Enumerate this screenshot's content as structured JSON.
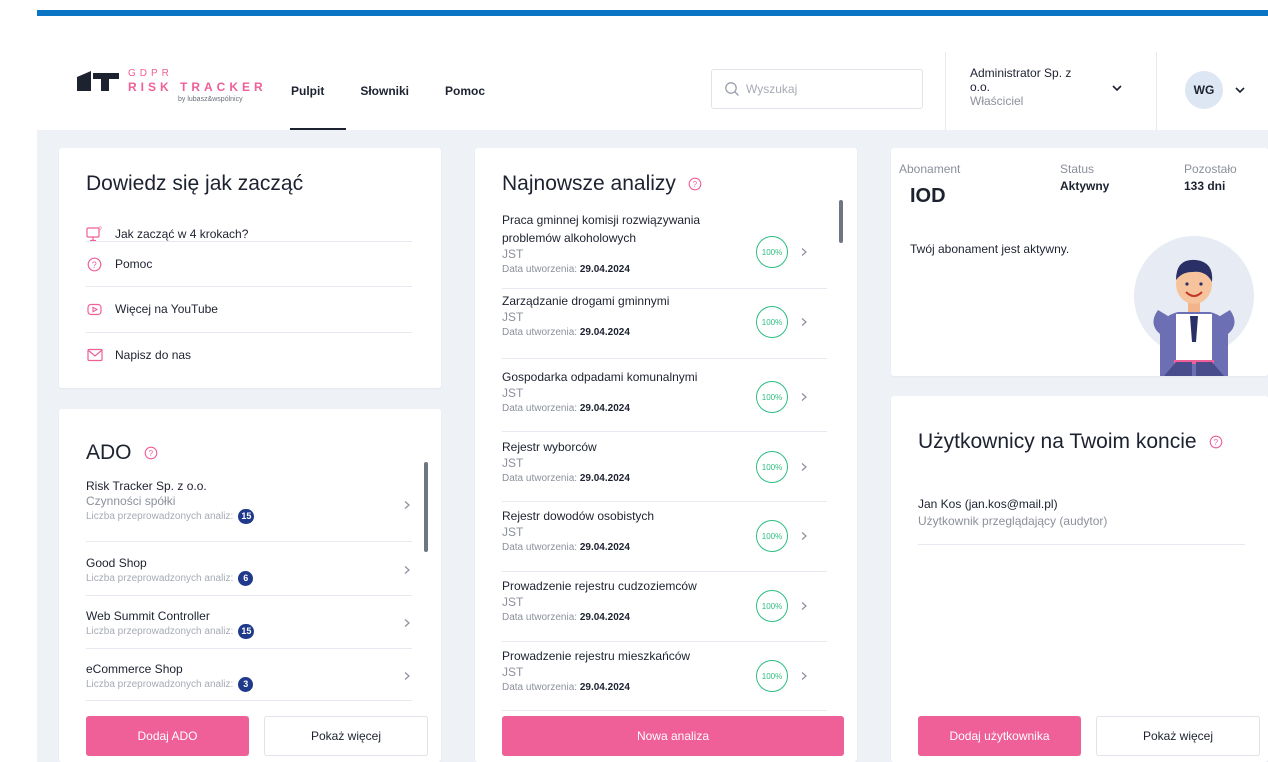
{
  "brand": {
    "gdpr": "GDPR",
    "product": "RISK TRACKER",
    "by": "by lubasz&wspólnicy"
  },
  "nav": [
    {
      "label": "Pulpit",
      "active": true
    },
    {
      "label": "Słowniki",
      "active": false
    },
    {
      "label": "Pomoc",
      "active": false
    }
  ],
  "search": {
    "placeholder": "Wyszukaj",
    "value": ""
  },
  "account": {
    "company": "Administrator Sp. z o.o.",
    "role": "Właściciel"
  },
  "user": {
    "initials": "WG"
  },
  "colors": {
    "accent": "#ef5f98",
    "topbar": "#0c74c4",
    "badge": "#1f3a8a",
    "progress": "#2ebd80"
  },
  "getting_started": {
    "title": "Dowiedz się jak zacząć",
    "items": [
      {
        "label": "Jak zacząć w 4 krokach?",
        "icon": "monitor-question-icon"
      },
      {
        "label": "Pomoc",
        "icon": "help-circle-icon"
      },
      {
        "label": "Więcej na YouTube",
        "icon": "youtube-play-icon"
      },
      {
        "label": "Napisz do nas",
        "icon": "mail-icon"
      }
    ]
  },
  "ado": {
    "title": "ADO",
    "count_label": "Liczba przeprowadzonych analiz:",
    "items": [
      {
        "name": "Risk Tracker Sp. z o.o.",
        "sub": "Czynności spółki",
        "count": "15"
      },
      {
        "name": "Good Shop",
        "sub": "",
        "count": "6"
      },
      {
        "name": "Web Summit Controller",
        "sub": "",
        "count": "15"
      },
      {
        "name": "eCommerce Shop",
        "sub": "",
        "count": "3"
      }
    ],
    "add_label": "Dodaj ADO",
    "more_label": "Pokaż więcej"
  },
  "analyses": {
    "title": "Najnowsze analizy",
    "date_label": "Data utworzenia:",
    "items": [
      {
        "title": "Praca gminnej komisji rozwiązywania problemów alkoholowych",
        "type": "JST",
        "date": "29.04.2024",
        "progress": "100%"
      },
      {
        "title": "Zarządzanie drogami gminnymi",
        "type": "JST",
        "date": "29.04.2024",
        "progress": "100%"
      },
      {
        "title": "Gospodarka odpadami komunalnymi",
        "type": "JST",
        "date": "29.04.2024",
        "progress": "100%"
      },
      {
        "title": "Rejestr wyborców",
        "type": "JST",
        "date": "29.04.2024",
        "progress": "100%"
      },
      {
        "title": "Rejestr dowodów osobistych",
        "type": "JST",
        "date": "29.04.2024",
        "progress": "100%"
      },
      {
        "title": "Prowadzenie rejestru cudzoziemców",
        "type": "JST",
        "date": "29.04.2024",
        "progress": "100%"
      },
      {
        "title": "Prowadzenie rejestru mieszkańców",
        "type": "JST",
        "date": "29.04.2024",
        "progress": "100%"
      }
    ],
    "new_label": "Nowa analiza"
  },
  "subscription": {
    "plan_label": "Abonament",
    "plan": "IOD",
    "status_label": "Status",
    "status": "Aktywny",
    "remaining_label": "Pozostało",
    "remaining": "133 dni",
    "note": "Twój abonament jest aktywny."
  },
  "users": {
    "title": "Użytkownicy na Twoim koncie",
    "items": [
      {
        "name": "Jan Kos (jan.kos@mail.pl)",
        "role": "Użytkownik przeglądający (audytor)"
      }
    ],
    "add_label": "Dodaj użytkownika",
    "more_label": "Pokaż więcej"
  }
}
